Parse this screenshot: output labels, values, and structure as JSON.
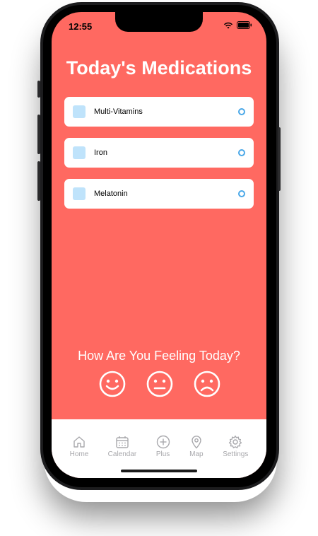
{
  "status": {
    "time": "12:55"
  },
  "title": "Today's Medications",
  "medications": [
    {
      "label": "Multi-Vitamins"
    },
    {
      "label": "Iron"
    },
    {
      "label": "Melatonin"
    }
  ],
  "feeling": {
    "question": "How Are You Feeling Today?",
    "options": [
      "happy-face-icon",
      "neutral-face-icon",
      "sad-face-icon"
    ]
  },
  "tabbar": {
    "items": [
      {
        "label": "Home",
        "icon": "home-icon"
      },
      {
        "label": "Calendar",
        "icon": "calendar-icon"
      },
      {
        "label": "Plus",
        "icon": "plus-circle-icon"
      },
      {
        "label": "Map",
        "icon": "map-pin-icon"
      },
      {
        "label": "Settings",
        "icon": "gear-icon"
      }
    ]
  },
  "colors": {
    "background": "#ff6961",
    "card": "#ffffff",
    "icon_fill": "#bfe3fb",
    "radio": "#4aa8e8",
    "tab_inactive": "#a8a8ac"
  }
}
